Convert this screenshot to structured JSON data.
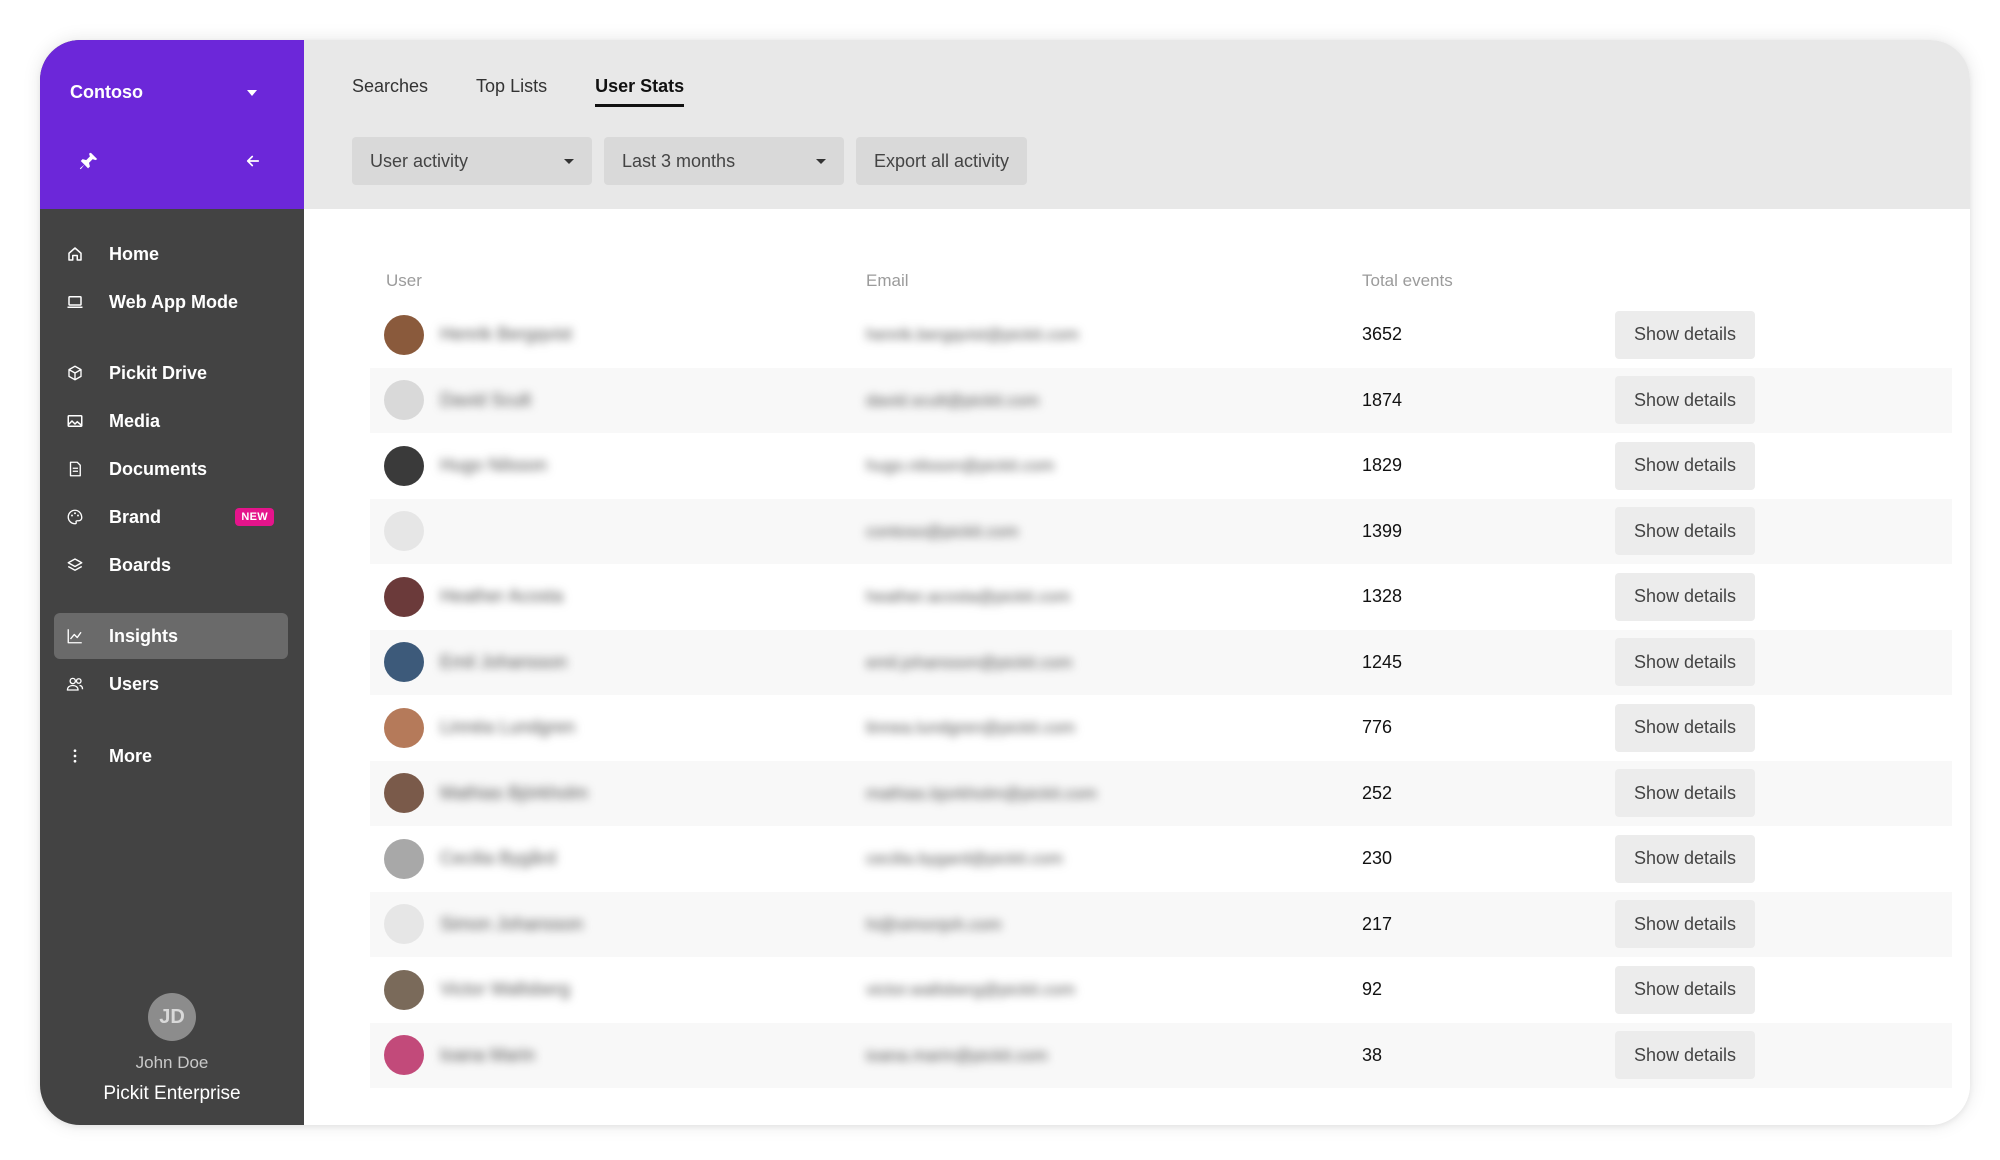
{
  "sidebar": {
    "org_name": "Contoso",
    "nav": [
      {
        "label": "Home",
        "icon": "home-icon"
      },
      {
        "label": "Web App Mode",
        "icon": "laptop-icon"
      },
      {
        "label": "Pickit Drive",
        "icon": "cube-icon"
      },
      {
        "label": "Media",
        "icon": "image-icon"
      },
      {
        "label": "Documents",
        "icon": "document-icon"
      },
      {
        "label": "Brand",
        "icon": "palette-icon",
        "badge": "NEW"
      },
      {
        "label": "Boards",
        "icon": "layers-icon"
      },
      {
        "label": "Insights",
        "icon": "chart-icon",
        "active": true
      },
      {
        "label": "Users",
        "icon": "users-icon"
      },
      {
        "label": "More",
        "icon": "more-vertical-icon"
      }
    ],
    "profile": {
      "initials": "JD",
      "name": "John Doe",
      "plan": "Pickit Enterprise"
    }
  },
  "header": {
    "tabs": [
      {
        "label": "Searches"
      },
      {
        "label": "Top Lists"
      },
      {
        "label": "User Stats",
        "active": true
      }
    ],
    "filters": {
      "type": "User activity",
      "period": "Last 3 months",
      "export_label": "Export all activity"
    }
  },
  "table": {
    "columns": [
      "User",
      "Email",
      "Total events"
    ],
    "action_label": "Show details",
    "rows": [
      {
        "name": "Henrik Bergqvist",
        "email": "henrik.bergqvist@pickit.com",
        "total": "3652",
        "avatar_color": "#8a5a3c"
      },
      {
        "name": "David Scult",
        "email": "david.scult@pickit.com",
        "total": "1874",
        "avatar_color": "#d9d9d9"
      },
      {
        "name": "Hugo Nilsson",
        "email": "hugo.nilsson@pickit.com",
        "total": "1829",
        "avatar_color": "#3a3a3a"
      },
      {
        "name": "",
        "email": "contoso@pickit.com",
        "total": "1399",
        "avatar_color": "#e6e6e6"
      },
      {
        "name": "Heather Acosta",
        "email": "heather.acosta@pickit.com",
        "total": "1328",
        "avatar_color": "#6b3a3a"
      },
      {
        "name": "Emil Johansson",
        "email": "emil.johansson@pickit.com",
        "total": "1245",
        "avatar_color": "#3d5a7a"
      },
      {
        "name": "Linnéa Lundgren",
        "email": "linnea.lundgren@pickit.com",
        "total": "776",
        "avatar_color": "#b57a5a"
      },
      {
        "name": "Mathias Björkholm",
        "email": "mathias.bjorkholm@pickit.com",
        "total": "252",
        "avatar_color": "#7a5a4a"
      },
      {
        "name": "Cecilia Bygård",
        "email": "cecilia.bygard@pickit.com",
        "total": "230",
        "avatar_color": "#a8a8a8"
      },
      {
        "name": "Simon Johansson",
        "email": "hi@simonjoh.com",
        "total": "217",
        "avatar_color": "#e6e6e6"
      },
      {
        "name": "Victor Wallsberg",
        "email": "victor.wallsberg@pickit.com",
        "total": "92",
        "avatar_color": "#7a6a5a"
      },
      {
        "name": "Ioana Marin",
        "email": "ioana.marin@pickit.com",
        "total": "38",
        "avatar_color": "#c24a7a"
      }
    ]
  }
}
